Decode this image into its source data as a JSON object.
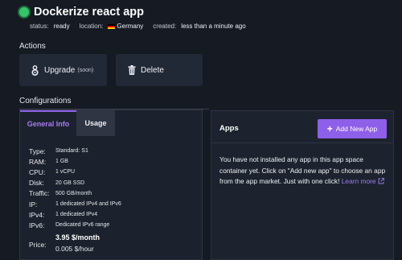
{
  "app": {
    "name": "Dockerize react app",
    "status_color": "#35c46a",
    "status_key": "status:",
    "status_value": "ready",
    "location_key": "location:",
    "location_value": "Germany",
    "location_flag": "germany-flag",
    "created_key": "created:",
    "created_value": "less than a minute ago"
  },
  "actions": {
    "title": "Actions",
    "upgrade_label": "Upgrade",
    "upgrade_soon": "(soon)",
    "upgrade_icon": "gem-icon",
    "delete_label": "Delete",
    "delete_icon": "trash-icon"
  },
  "configurations": {
    "title": "Configurations",
    "tabs": [
      {
        "label": "General Info",
        "active": true
      },
      {
        "label": "Usage",
        "active": false
      }
    ],
    "specs": [
      {
        "key": "Type:",
        "value": "Standard:  S1"
      },
      {
        "key": "RAM:",
        "value": "1 GB"
      },
      {
        "key": "CPU:",
        "value": "1 vCPU"
      },
      {
        "key": "Disk:",
        "value": "20 GB SSD"
      },
      {
        "key": "Traffic:",
        "value": "500 GB/month"
      },
      {
        "key": "IP:",
        "value": "1 dedicated IPv4 and IPv6"
      },
      {
        "key": "IPv4:",
        "value": "1 dedicated IPv4"
      },
      {
        "key": "IPv6:",
        "value": "Dedicated IPv6 range"
      }
    ],
    "price_key": "Price:",
    "price_monthly": "3.95 $/month",
    "price_hourly": "0.005 $/hour"
  },
  "apps": {
    "title": "Apps",
    "add_button_label": "Add New App",
    "empty_text": "You have not installed any app in this app space container yet. Click on \"Add new app\" to choose an app from the app market. Just with one click!",
    "learn_more": "Learn more",
    "accent_color": "#8e5fe8"
  }
}
